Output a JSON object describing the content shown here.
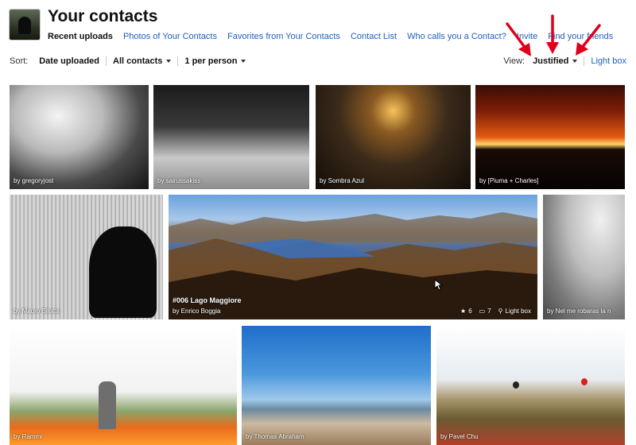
{
  "header": {
    "title": "Your contacts",
    "subnav": [
      {
        "label": "Recent uploads",
        "current": true
      },
      {
        "label": "Photos of Your Contacts",
        "current": false
      },
      {
        "label": "Favorites from Your Contacts",
        "current": false
      },
      {
        "label": "Contact List",
        "current": false
      },
      {
        "label": "Who calls you a Contact?",
        "current": false
      },
      {
        "label": "Invite",
        "current": false
      },
      {
        "label": "Find your friends",
        "current": false
      }
    ]
  },
  "sortbar": {
    "label": "Sort:",
    "sort_value": "Date uploaded",
    "filter_value": "All contacts",
    "per_person_value": "1 per person"
  },
  "viewbar": {
    "label": "View:",
    "current": "Justified",
    "other": "Light box"
  },
  "photos": [
    {
      "byline": "by gregoryjost"
    },
    {
      "byline": "by sairussakiss"
    },
    {
      "byline": "by Sombra Azul"
    },
    {
      "byline": "by [Piuma + Charles]"
    },
    {
      "byline": "by Mauro Bilotta"
    },
    {
      "title": "#006 Lago Maggiore",
      "byline": "by Enrico Boggia",
      "faves": "6",
      "comments": "7",
      "lightbox": "Light box"
    },
    {
      "byline": "by Nel me robaras la n"
    },
    {
      "byline": "by Rammi"
    },
    {
      "byline": "by Thomas Abraham"
    },
    {
      "byline": "by Pavel Chu"
    }
  ],
  "annotation": {
    "color": "#e0001b"
  },
  "colors": {
    "link": "#1f5fbf"
  }
}
